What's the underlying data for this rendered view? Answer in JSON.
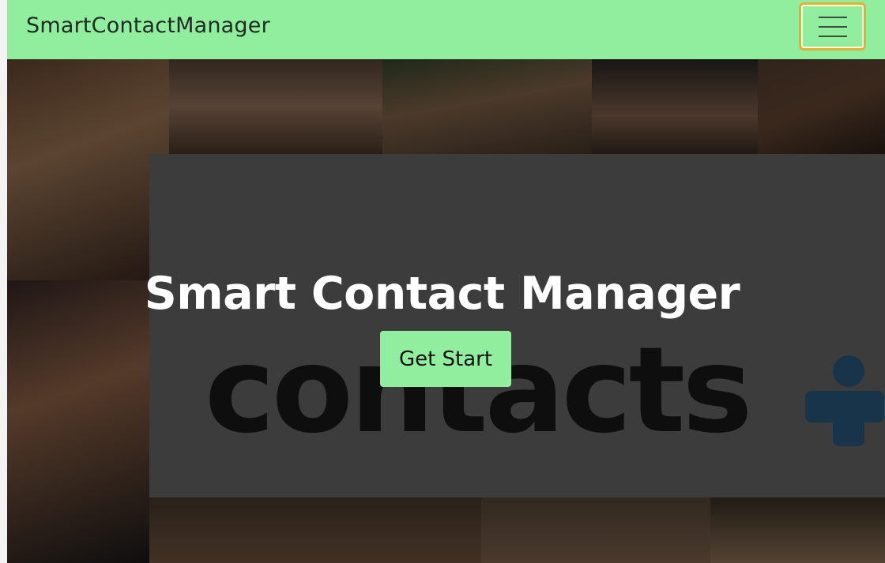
{
  "navbar": {
    "brand": "SmartContactManager",
    "toggler_icon": "hamburger-menu-icon"
  },
  "hero": {
    "background_word": "contacts",
    "title": "Smart Contact Manager",
    "cta_label": "Get Start"
  },
  "colors": {
    "navbar_bg": "#90ee9e",
    "cta_bg": "#90ee9e",
    "toggler_focus_border": "#e0b13a",
    "hero_title": "#ffffff"
  }
}
